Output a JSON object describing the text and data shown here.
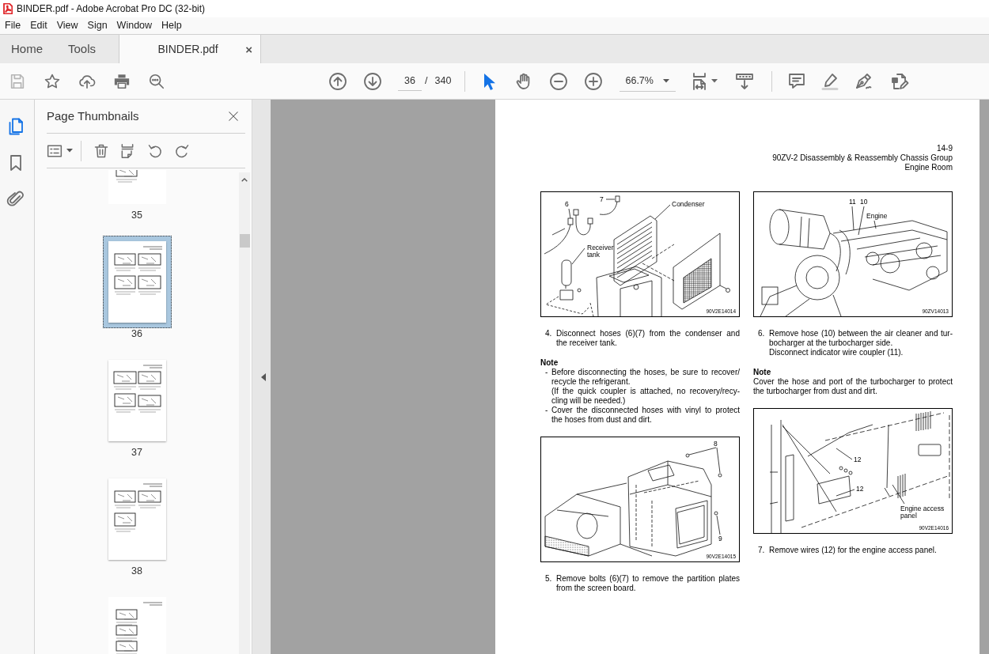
{
  "window": {
    "title": "BINDER.pdf - Adobe Acrobat Pro DC (32-bit)"
  },
  "menu": [
    "File",
    "Edit",
    "View",
    "Sign",
    "Window",
    "Help"
  ],
  "tabs": [
    {
      "label": "Home",
      "selected": false
    },
    {
      "label": "Tools",
      "selected": false
    },
    {
      "label": "BINDER.pdf",
      "selected": true,
      "close": "×"
    }
  ],
  "toolbar": {
    "quick_tools": [
      {
        "kind": "save",
        "disabled": true
      },
      {
        "kind": "star",
        "disabled": false
      },
      {
        "kind": "upload",
        "disabled": false
      },
      {
        "kind": "print",
        "disabled": false
      },
      {
        "kind": "search",
        "disabled": false
      }
    ],
    "page_number": "36",
    "page_separator": "/",
    "page_count": "340",
    "tools": [
      {
        "kind": "select",
        "selected": true
      },
      {
        "kind": "hand",
        "selected": false
      }
    ],
    "zoom": "66.7%"
  },
  "sidebar": {
    "rail": [
      {
        "kind": "pages",
        "selected": true
      },
      {
        "kind": "bookmarks",
        "selected": false
      },
      {
        "kind": "attachments",
        "selected": false
      }
    ],
    "title": "Page Thumbnails",
    "thumbnails": [
      {
        "label": "35",
        "selected": false
      },
      {
        "label": "36",
        "selected": true
      },
      {
        "label": "37",
        "selected": false
      },
      {
        "label": "38",
        "selected": false
      },
      {
        "selected": false
      }
    ]
  },
  "document": {
    "header": [
      "14-9",
      "90ZV-2 Disassembly & Reassembly Chassis Group",
      "Engine Room"
    ],
    "columns": [
      [
        {
          "kind": "figure",
          "labels": [
            "6",
            "7",
            "Condenser",
            "Receiver\ntank"
          ],
          "code": "90V2E14014"
        },
        {
          "kind": "step",
          "number": "4.",
          "paragraphs": [
            "Disconnect hoses (6)(7) from the condenser and\nthe receiver tank."
          ]
        },
        {
          "kind": "note",
          "heading": "Note",
          "bullets": [
            {
              "marker": "-",
              "paragraphs": [
                "Before disconnecting the hoses, be sure to recover/\nrecycle the refrigerant.",
                "(If the quick coupler is attached, no recovery/recy-\ncling will be needed.)"
              ]
            },
            {
              "marker": "-",
              "paragraphs": [
                "Cover the disconnected hoses with vinyl to protect\nthe hoses from dust and dirt."
              ]
            }
          ]
        },
        {
          "kind": "figure",
          "labels": [
            "8",
            "9"
          ],
          "code": "90V2E14015"
        },
        {
          "kind": "step",
          "number": "5.",
          "paragraphs": [
            "Remove bolts (6)(7) to remove the partition plates\nfrom the screen board."
          ]
        }
      ],
      [
        {
          "kind": "figure",
          "labels": [
            "11",
            "10",
            "Engine"
          ],
          "code": "90ZV14013"
        },
        {
          "kind": "step",
          "number": "6.",
          "paragraphs": [
            "Remove hose (10) between the air cleaner and tur-\nbocharger at the turbocharger side.",
            "Disconnect indicator wire coupler (11)."
          ]
        },
        {
          "kind": "note",
          "heading": "Note",
          "paragraphs": [
            "Cover the hose and port of the turbocharger to protect\nthe turbocharger from dust and dirt."
          ]
        },
        {
          "kind": "figure",
          "labels": [
            "12",
            "12",
            "Engine access\npanel"
          ],
          "code": "90V2E14016"
        },
        {
          "kind": "step",
          "number": "7.",
          "paragraphs": [
            "Remove wires (12) for the engine access panel."
          ]
        }
      ]
    ]
  }
}
